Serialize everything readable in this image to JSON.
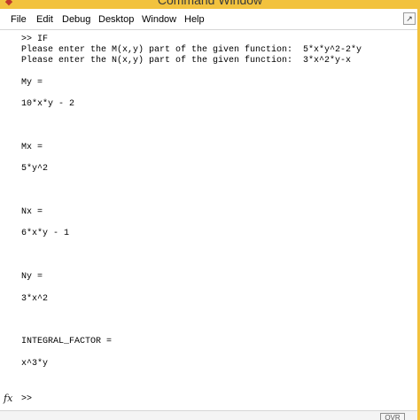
{
  "window": {
    "title": "Command Window"
  },
  "menu": {
    "items": [
      "File",
      "Edit",
      "Debug",
      "Desktop",
      "Window",
      "Help"
    ]
  },
  "console": {
    "lines": [
      ">> IF",
      "Please enter the M(x,y) part of the given function:  5*x*y^2-2*y",
      "Please enter the N(x,y) part of the given function:  3*x^2*y-x",
      "",
      "My =",
      "",
      "10*x*y - 2",
      "",
      "",
      "",
      "Mx =",
      "",
      "5*y^2",
      "",
      "",
      "",
      "Nx =",
      "",
      "6*x*y - 1",
      "",
      "",
      "",
      "Ny =",
      "",
      "3*x^2",
      "",
      "",
      "",
      "INTEGRAL_FACTOR =",
      "",
      "x^3*y"
    ],
    "prompt": ">>",
    "fx_icon": "fx-icon"
  },
  "statusbar": {
    "mode": "OVR"
  },
  "colors": {
    "title_bar": "#f2c23e",
    "background": "#ffffff",
    "text": "#000000"
  }
}
